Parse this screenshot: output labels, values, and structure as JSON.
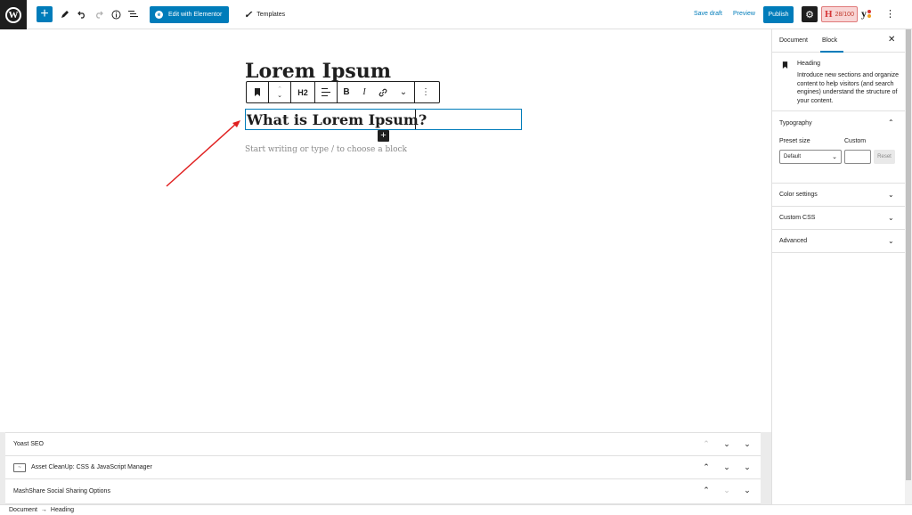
{
  "toolbar": {
    "wp_logo": "W",
    "add_icon": "+",
    "tools_icon": "pencil-icon",
    "undo_icon": "undo-icon",
    "redo_icon": "redo-icon",
    "info_icon": "info-icon",
    "outline_icon": "list-view-icon",
    "edit_elementor_label": "Edit with Elementor",
    "templates_label": "Templates",
    "save_draft_label": "Save draft",
    "preview_label": "Preview",
    "publish_label": "Publish",
    "seo_score": "28/100",
    "seo_score_letter": "H"
  },
  "editor": {
    "post_title": "Lorem Ipsum",
    "heading_text": "What is Lorem Ipsum?",
    "heading_level": "H2",
    "placeholder": "Start writing or type / to choose a block"
  },
  "sidebar": {
    "tabs": [
      "Document",
      "Block"
    ],
    "active_tab": "Block",
    "block_name": "Heading",
    "block_description": "Introduce new sections and organize content to help visitors (and search engines) understand the structure of your content.",
    "typography_title": "Typography",
    "preset_size_label": "Preset size",
    "custom_label": "Custom",
    "preset_value": "Default",
    "reset_label": "Reset",
    "panels": [
      "Color settings",
      "Custom CSS",
      "Advanced"
    ]
  },
  "metaboxes": [
    {
      "label": "Yoast SEO"
    },
    {
      "label": "Asset CleanUp: CSS & JavaScript Manager"
    },
    {
      "label": "MashShare Social Sharing Options"
    }
  ],
  "footer": {
    "breadcrumb_root": "Document",
    "breadcrumb_sep": "→",
    "breadcrumb_current": "Heading"
  },
  "colors": {
    "accent": "#007cba",
    "annotation_arrow": "#e02020"
  }
}
